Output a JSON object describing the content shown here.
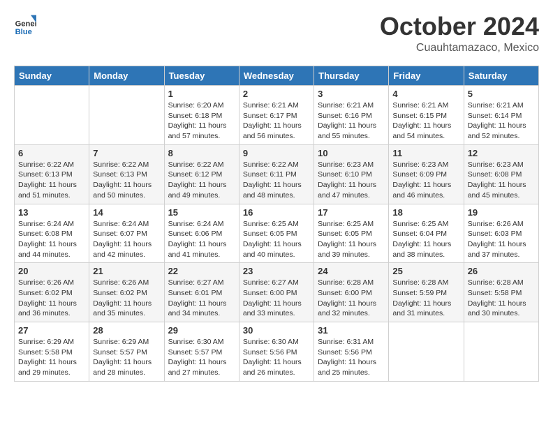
{
  "header": {
    "logo": {
      "general": "General",
      "blue": "Blue"
    },
    "month": "October 2024",
    "location": "Cuauhtamazaco, Mexico"
  },
  "weekdays": [
    "Sunday",
    "Monday",
    "Tuesday",
    "Wednesday",
    "Thursday",
    "Friday",
    "Saturday"
  ],
  "weeks": [
    [
      {
        "day": "",
        "info": ""
      },
      {
        "day": "",
        "info": ""
      },
      {
        "day": "1",
        "info": "Sunrise: 6:20 AM\nSunset: 6:18 PM\nDaylight: 11 hours and 57 minutes."
      },
      {
        "day": "2",
        "info": "Sunrise: 6:21 AM\nSunset: 6:17 PM\nDaylight: 11 hours and 56 minutes."
      },
      {
        "day": "3",
        "info": "Sunrise: 6:21 AM\nSunset: 6:16 PM\nDaylight: 11 hours and 55 minutes."
      },
      {
        "day": "4",
        "info": "Sunrise: 6:21 AM\nSunset: 6:15 PM\nDaylight: 11 hours and 54 minutes."
      },
      {
        "day": "5",
        "info": "Sunrise: 6:21 AM\nSunset: 6:14 PM\nDaylight: 11 hours and 52 minutes."
      }
    ],
    [
      {
        "day": "6",
        "info": "Sunrise: 6:22 AM\nSunset: 6:13 PM\nDaylight: 11 hours and 51 minutes."
      },
      {
        "day": "7",
        "info": "Sunrise: 6:22 AM\nSunset: 6:13 PM\nDaylight: 11 hours and 50 minutes."
      },
      {
        "day": "8",
        "info": "Sunrise: 6:22 AM\nSunset: 6:12 PM\nDaylight: 11 hours and 49 minutes."
      },
      {
        "day": "9",
        "info": "Sunrise: 6:22 AM\nSunset: 6:11 PM\nDaylight: 11 hours and 48 minutes."
      },
      {
        "day": "10",
        "info": "Sunrise: 6:23 AM\nSunset: 6:10 PM\nDaylight: 11 hours and 47 minutes."
      },
      {
        "day": "11",
        "info": "Sunrise: 6:23 AM\nSunset: 6:09 PM\nDaylight: 11 hours and 46 minutes."
      },
      {
        "day": "12",
        "info": "Sunrise: 6:23 AM\nSunset: 6:08 PM\nDaylight: 11 hours and 45 minutes."
      }
    ],
    [
      {
        "day": "13",
        "info": "Sunrise: 6:24 AM\nSunset: 6:08 PM\nDaylight: 11 hours and 44 minutes."
      },
      {
        "day": "14",
        "info": "Sunrise: 6:24 AM\nSunset: 6:07 PM\nDaylight: 11 hours and 42 minutes."
      },
      {
        "day": "15",
        "info": "Sunrise: 6:24 AM\nSunset: 6:06 PM\nDaylight: 11 hours and 41 minutes."
      },
      {
        "day": "16",
        "info": "Sunrise: 6:25 AM\nSunset: 6:05 PM\nDaylight: 11 hours and 40 minutes."
      },
      {
        "day": "17",
        "info": "Sunrise: 6:25 AM\nSunset: 6:05 PM\nDaylight: 11 hours and 39 minutes."
      },
      {
        "day": "18",
        "info": "Sunrise: 6:25 AM\nSunset: 6:04 PM\nDaylight: 11 hours and 38 minutes."
      },
      {
        "day": "19",
        "info": "Sunrise: 6:26 AM\nSunset: 6:03 PM\nDaylight: 11 hours and 37 minutes."
      }
    ],
    [
      {
        "day": "20",
        "info": "Sunrise: 6:26 AM\nSunset: 6:02 PM\nDaylight: 11 hours and 36 minutes."
      },
      {
        "day": "21",
        "info": "Sunrise: 6:26 AM\nSunset: 6:02 PM\nDaylight: 11 hours and 35 minutes."
      },
      {
        "day": "22",
        "info": "Sunrise: 6:27 AM\nSunset: 6:01 PM\nDaylight: 11 hours and 34 minutes."
      },
      {
        "day": "23",
        "info": "Sunrise: 6:27 AM\nSunset: 6:00 PM\nDaylight: 11 hours and 33 minutes."
      },
      {
        "day": "24",
        "info": "Sunrise: 6:28 AM\nSunset: 6:00 PM\nDaylight: 11 hours and 32 minutes."
      },
      {
        "day": "25",
        "info": "Sunrise: 6:28 AM\nSunset: 5:59 PM\nDaylight: 11 hours and 31 minutes."
      },
      {
        "day": "26",
        "info": "Sunrise: 6:28 AM\nSunset: 5:58 PM\nDaylight: 11 hours and 30 minutes."
      }
    ],
    [
      {
        "day": "27",
        "info": "Sunrise: 6:29 AM\nSunset: 5:58 PM\nDaylight: 11 hours and 29 minutes."
      },
      {
        "day": "28",
        "info": "Sunrise: 6:29 AM\nSunset: 5:57 PM\nDaylight: 11 hours and 28 minutes."
      },
      {
        "day": "29",
        "info": "Sunrise: 6:30 AM\nSunset: 5:57 PM\nDaylight: 11 hours and 27 minutes."
      },
      {
        "day": "30",
        "info": "Sunrise: 6:30 AM\nSunset: 5:56 PM\nDaylight: 11 hours and 26 minutes."
      },
      {
        "day": "31",
        "info": "Sunrise: 6:31 AM\nSunset: 5:56 PM\nDaylight: 11 hours and 25 minutes."
      },
      {
        "day": "",
        "info": ""
      },
      {
        "day": "",
        "info": ""
      }
    ]
  ]
}
